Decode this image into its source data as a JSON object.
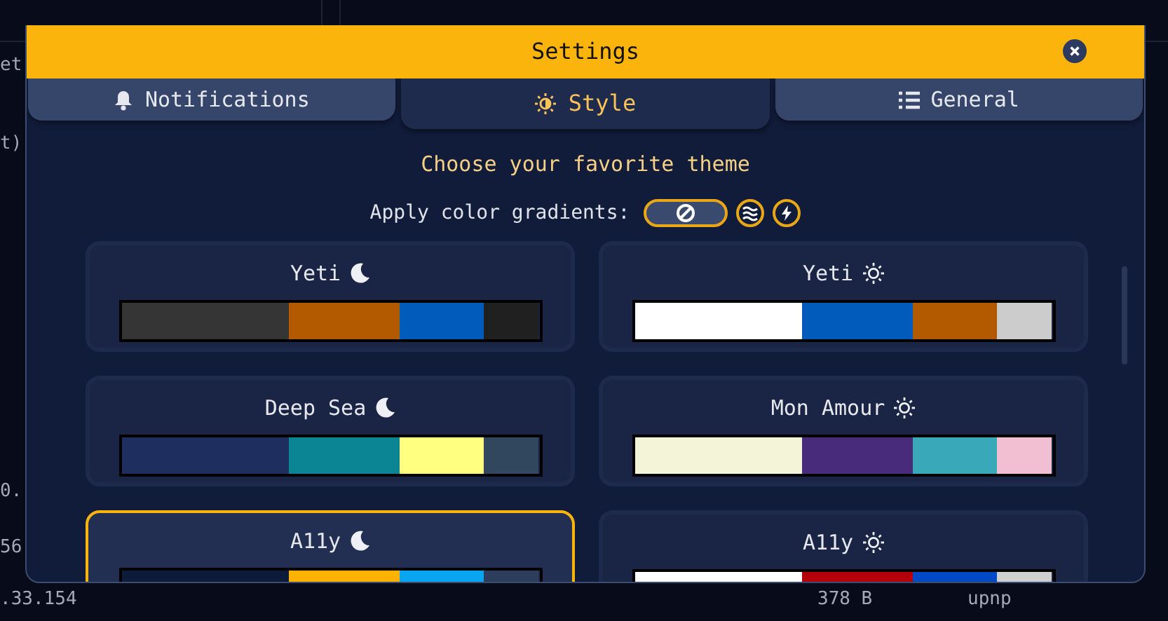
{
  "background": {
    "texts": [
      "et",
      "t)",
      "0.",
      "56",
      ".33.154",
      "378 B",
      "upnp"
    ]
  },
  "modal": {
    "title": "Settings",
    "tabs": [
      {
        "label": "Notifications",
        "selected": false
      },
      {
        "label": "Style",
        "selected": true
      },
      {
        "label": "General",
        "selected": false
      }
    ],
    "heading": "Choose your favorite theme",
    "gradient_label": "Apply color gradients:",
    "gradient_options": [
      {
        "kind": "none",
        "selected": true
      },
      {
        "kind": "waves",
        "selected": false
      },
      {
        "kind": "lightning",
        "selected": false
      }
    ],
    "themes": [
      {
        "name": "Yeti",
        "kind": "dark",
        "selected": false,
        "segments": [
          {
            "color": "#353535"
          },
          {
            "color": "#b35900"
          },
          {
            "color": "#005bbb"
          },
          {
            "color": "#202020"
          }
        ]
      },
      {
        "name": "Yeti",
        "kind": "light",
        "selected": false,
        "segments": [
          {
            "color": "#ffffff"
          },
          {
            "color": "#005bbb"
          },
          {
            "color": "#b35900"
          },
          {
            "color": "#cccccc"
          }
        ]
      },
      {
        "name": "Deep Sea",
        "kind": "dark",
        "selected": false,
        "segments": [
          {
            "color": "#1e2e5e"
          },
          {
            "color": "#0b8494"
          },
          {
            "color": "#ffff80"
          },
          {
            "color": "#31475e"
          }
        ]
      },
      {
        "name": "Mon Amour",
        "kind": "light",
        "selected": false,
        "segments": [
          {
            "color": "#f4f4d8"
          },
          {
            "color": "#482c7b"
          },
          {
            "color": "#39a8b9"
          },
          {
            "color": "#f2bfd2"
          }
        ]
      },
      {
        "name": "A11y",
        "kind": "dark",
        "selected": true,
        "segments": [
          {
            "color": "#0e1a3a"
          },
          {
            "color": "#ffb300"
          },
          {
            "color": "#0aa5f0"
          },
          {
            "color": "#2c3e5c"
          }
        ]
      },
      {
        "name": "A11y",
        "kind": "light",
        "selected": false,
        "segments": [
          {
            "color": "#ffffff"
          },
          {
            "color": "#b3000a"
          },
          {
            "color": "#0049c6"
          },
          {
            "color": "#d0d0d0"
          }
        ]
      }
    ]
  }
}
